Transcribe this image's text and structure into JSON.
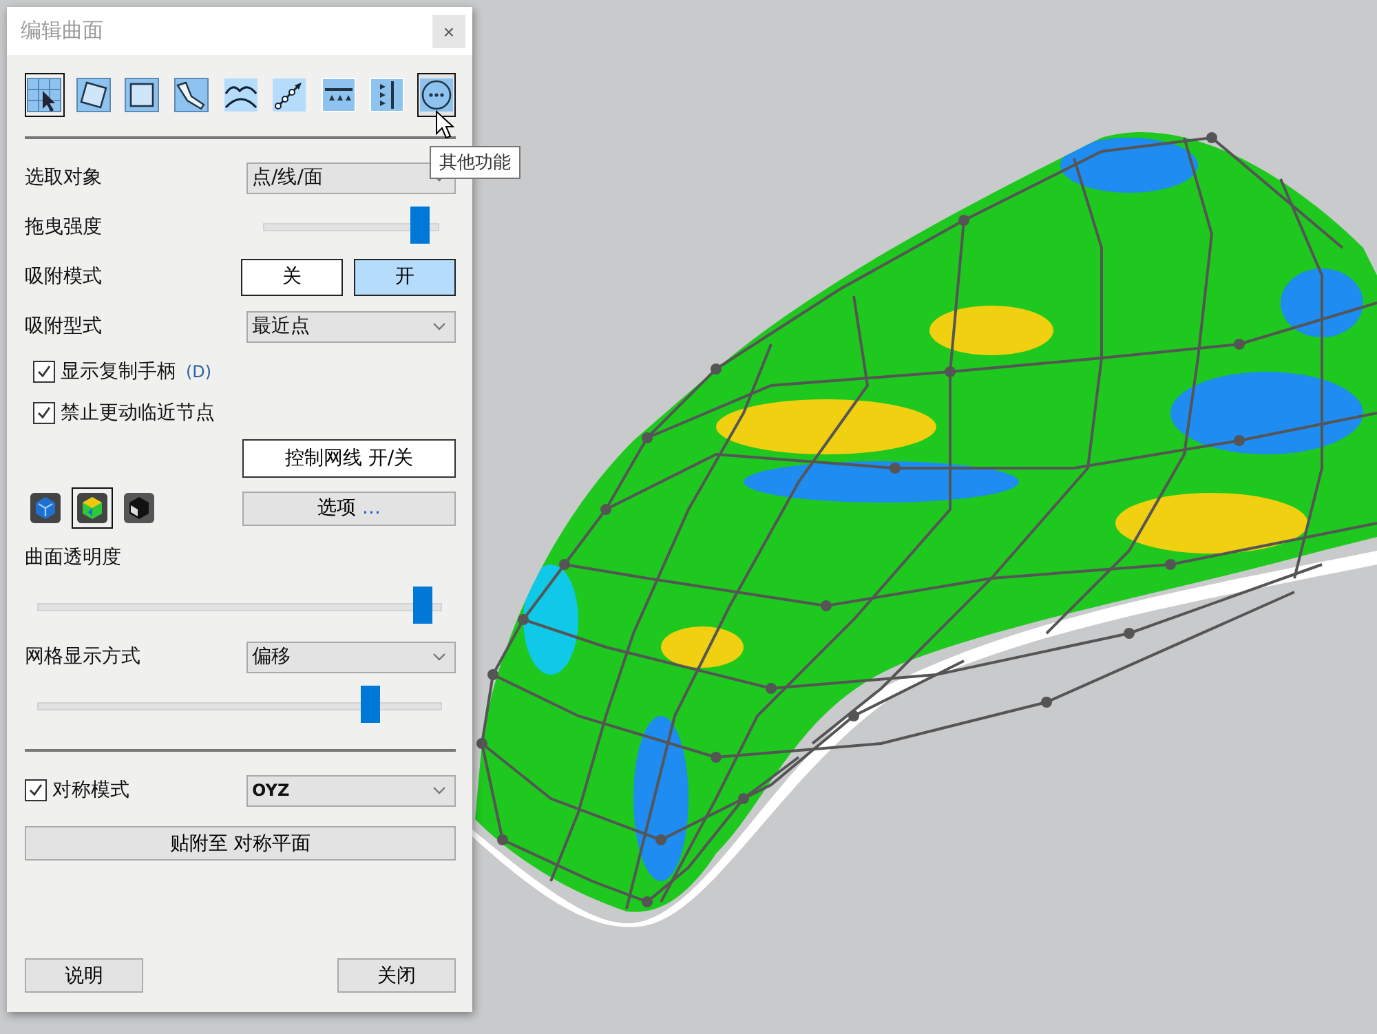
{
  "window": {
    "title": "编辑曲面",
    "close": "×"
  },
  "toolbar": [
    {
      "kind": "select",
      "selected": true,
      "hovered": false
    },
    {
      "kind": "quad",
      "selected": false,
      "hovered": false
    },
    {
      "kind": "rect",
      "selected": false,
      "hovered": false
    },
    {
      "kind": "brush",
      "selected": false,
      "hovered": false
    },
    {
      "kind": "wave",
      "selected": false,
      "hovered": false
    },
    {
      "kind": "line",
      "selected": false,
      "hovered": false
    },
    {
      "kind": "edge-h",
      "selected": false,
      "hovered": false
    },
    {
      "kind": "edge-v",
      "selected": false,
      "hovered": false
    },
    {
      "kind": "more",
      "selected": true,
      "hovered": true
    }
  ],
  "tooltip": "其他功能",
  "select_target": {
    "label": "选取对象",
    "value": "点/线/面"
  },
  "drag_strength": {
    "label": "拖曳强度",
    "level": 0.95
  },
  "snap_mode": {
    "label": "吸附模式",
    "options": [
      {
        "label": "关",
        "selected": false
      },
      {
        "label": "开",
        "selected": true
      }
    ]
  },
  "snap_type": {
    "label": "吸附型式",
    "value": "最近点"
  },
  "checkboxes": [
    {
      "label": "显示复制手柄",
      "hint": "(D)",
      "checked": true
    },
    {
      "label": "禁止更动临近节点",
      "checked": true
    }
  ],
  "mesh_toggle_button": "控制网线 开/关",
  "display_modes": [
    {
      "kind": "shaded",
      "selected": false
    },
    {
      "kind": "analysis",
      "selected": true
    },
    {
      "kind": "wire",
      "selected": false
    }
  ],
  "options_button": {
    "label": "选项",
    "suffix": "..."
  },
  "transparency": {
    "label": "曲面透明度",
    "level": 0.98
  },
  "mesh_display": {
    "label": "网格显示方式",
    "value": "偏移",
    "level": 0.85
  },
  "symmetry": {
    "label": "对称模式",
    "checked": true,
    "value": "OYZ"
  },
  "attach_button": "贴附至 对称平面",
  "footer": {
    "help": "说明",
    "close": "关闭"
  }
}
